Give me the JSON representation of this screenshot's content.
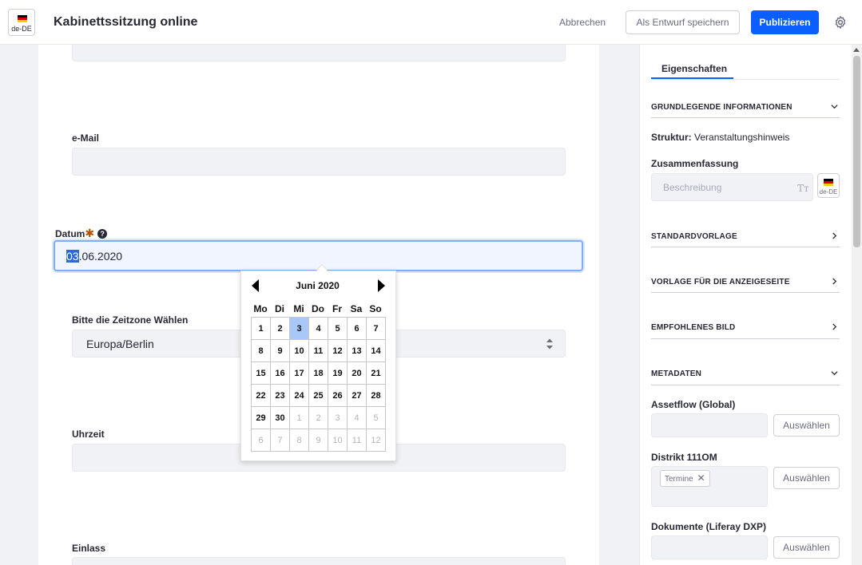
{
  "header": {
    "locale": "de-DE",
    "title": "Kabinettssitzung online",
    "cancel_label": "Abbrechen",
    "draft_label": "Als Entwurf speichern",
    "publish_label": "Publizieren",
    "settings_icon": "gear-icon",
    "accent_color": "#0b5fff"
  },
  "form": {
    "email_label": "e-Mail",
    "date_label": "Datum",
    "date_value_selected": "03",
    "date_value_rest": ".06.2020",
    "timezone_label": "Bitte die Zeitzone Wählen",
    "timezone_value": "Europa/Berlin",
    "time_label": "Uhrzeit",
    "entry_label": "Einlass"
  },
  "calendar": {
    "title": "Juni 2020",
    "weekdays": [
      "Mo",
      "Di",
      "Mi",
      "Do",
      "Fr",
      "Sa",
      "So"
    ],
    "weeks": [
      [
        "1",
        "2",
        "3",
        "4",
        "5",
        "6",
        "7"
      ],
      [
        "8",
        "9",
        "10",
        "11",
        "12",
        "13",
        "14"
      ],
      [
        "15",
        "16",
        "17",
        "18",
        "19",
        "20",
        "21"
      ],
      [
        "22",
        "23",
        "24",
        "25",
        "26",
        "27",
        "28"
      ],
      [
        "29",
        "30",
        "1",
        "2",
        "3",
        "4",
        "5"
      ],
      [
        "6",
        "7",
        "8",
        "9",
        "10",
        "11",
        "12"
      ]
    ],
    "selected_day": "3"
  },
  "panel": {
    "tab_label": "Eigenschaften",
    "section_basic": "GRUNDLEGENDE INFORMATIONEN",
    "structure_label": "Struktur:",
    "structure_value": "Veranstaltungshinweis",
    "summary_label": "Zusammenfassung",
    "summary_placeholder": "Beschreibung",
    "summary_locale": "de-DE",
    "section_default_template": "STANDARDVORLAGE",
    "section_display_template": "VORLAGE FÜR DIE ANZEIGESEITE",
    "section_featured_image": "EMPFOHLENES BILD",
    "section_metadata": "METADATEN",
    "assetflow_label": "Assetflow (Global)",
    "district_label": "Distrikt 111OM",
    "district_chip": "Termine",
    "documents_label": "Dokumente (Liferay DXP)",
    "select_label": "Auswählen"
  }
}
